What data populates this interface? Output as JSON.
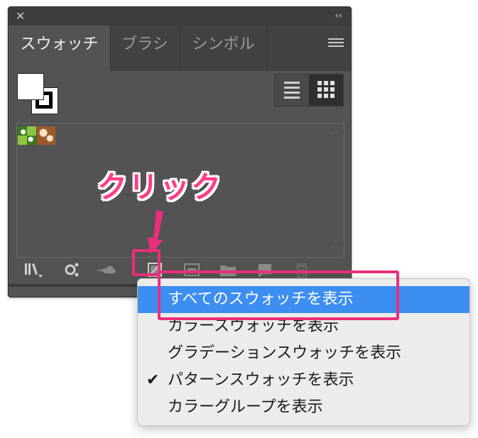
{
  "panel": {
    "close_glyph": "✕",
    "collapse_glyph": "‹‹",
    "tabs": [
      {
        "label": "スウォッチ",
        "active": true
      },
      {
        "label": "ブラシ",
        "active": false
      },
      {
        "label": "シンボル",
        "active": false
      }
    ],
    "icons": {
      "panel_menu": "hamburger-icon",
      "list_view": "list-view-icon",
      "grid_view": "grid-view-icon"
    },
    "toolbar_icons": [
      "swatch-libraries-icon",
      "add-to-library-icon",
      "cloud-sync-icon",
      "show-swatch-kinds-icon",
      "swatch-options-icon",
      "new-color-group-icon",
      "new-swatch-icon",
      "delete-swatch-icon"
    ]
  },
  "annotation": {
    "callout": "クリック",
    "accent": "#ea2e7c"
  },
  "menu": {
    "items": [
      {
        "label": "すべてのスウォッチを表示",
        "selected": true,
        "checked": false
      },
      {
        "label": "カラースウォッチを表示",
        "selected": false,
        "checked": false
      },
      {
        "label": "グラデーションスウォッチを表示",
        "selected": false,
        "checked": false
      },
      {
        "label": "パターンスウォッチを表示",
        "selected": false,
        "checked": true
      },
      {
        "label": "カラーグループを表示",
        "selected": false,
        "checked": false
      }
    ],
    "check_glyph": "✔",
    "highlight_color": "#3c8ef0"
  }
}
